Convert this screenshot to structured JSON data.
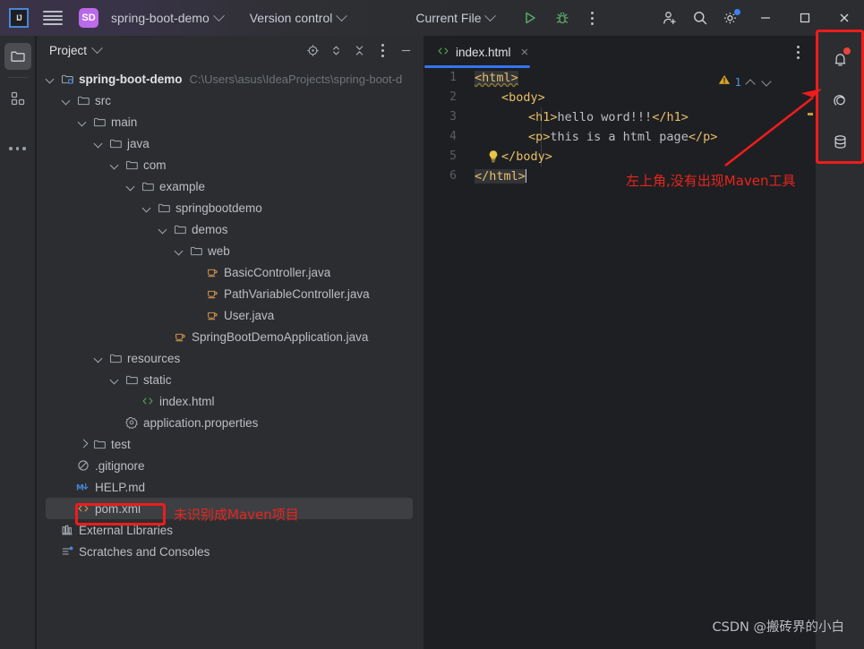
{
  "titlebar": {
    "ide_logo": "IJ",
    "menu_icon": "hamburger-menu-icon",
    "project_badge": "SD",
    "project_name": "spring-boot-demo",
    "version_control": "Version control",
    "run_config": "Current File",
    "run_icon": "run-icon",
    "debug_icon": "debug-icon",
    "more_icon": "more-options-icon",
    "account_icon": "add-account-icon",
    "search_icon": "search-icon",
    "settings_icon": "settings-gear-icon",
    "minimize": "minimize-icon",
    "maximize": "maximize-icon",
    "close": "close-icon",
    "accent": "#3574f0"
  },
  "activitybar": {
    "items": [
      {
        "name": "project-folder-icon",
        "active": true
      },
      {
        "name": "structure-icon",
        "active": false
      },
      {
        "name": "more-tool-windows-icon",
        "active": false
      }
    ]
  },
  "project_panel": {
    "title": "Project",
    "tools": [
      "locate-target-icon",
      "expand-collapse-icon",
      "collapse-all-icon",
      "panel-options-icon",
      "hide-panel-icon"
    ],
    "tree": [
      {
        "id": "root",
        "depth": 0,
        "arrow": "down",
        "icon": "module-folder-icon",
        "label": "spring-boot-demo",
        "sub": "C:\\Users\\asus\\IdeaProjects\\spring-boot-d",
        "bold": true
      },
      {
        "id": "src",
        "depth": 1,
        "arrow": "down",
        "icon": "folder-icon",
        "label": "src",
        "sub": ""
      },
      {
        "id": "main",
        "depth": 2,
        "arrow": "down",
        "icon": "folder-icon",
        "label": "main",
        "sub": ""
      },
      {
        "id": "java",
        "depth": 3,
        "arrow": "down",
        "icon": "folder-icon",
        "label": "java",
        "sub": ""
      },
      {
        "id": "com",
        "depth": 4,
        "arrow": "down",
        "icon": "folder-icon",
        "label": "com",
        "sub": ""
      },
      {
        "id": "example",
        "depth": 5,
        "arrow": "down",
        "icon": "folder-icon",
        "label": "example",
        "sub": ""
      },
      {
        "id": "sbdemo",
        "depth": 6,
        "arrow": "down",
        "icon": "folder-icon",
        "label": "springbootdemo",
        "sub": ""
      },
      {
        "id": "demos",
        "depth": 7,
        "arrow": "down",
        "icon": "folder-icon",
        "label": "demos",
        "sub": ""
      },
      {
        "id": "web",
        "depth": 8,
        "arrow": "down",
        "icon": "folder-icon",
        "label": "web",
        "sub": ""
      },
      {
        "id": "basicctl",
        "depth": 9,
        "arrow": "none",
        "icon": "java-class-icon",
        "label": "BasicController.java",
        "sub": ""
      },
      {
        "id": "pathvarctl",
        "depth": 9,
        "arrow": "none",
        "icon": "java-class-icon",
        "label": "PathVariableController.java",
        "sub": ""
      },
      {
        "id": "user",
        "depth": 9,
        "arrow": "none",
        "icon": "java-class-icon",
        "label": "User.java",
        "sub": ""
      },
      {
        "id": "sbapp",
        "depth": 7,
        "arrow": "none",
        "icon": "java-class-icon",
        "label": "SpringBootDemoApplication.java",
        "sub": ""
      },
      {
        "id": "resources",
        "depth": 3,
        "arrow": "down",
        "icon": "folder-icon",
        "label": "resources",
        "sub": ""
      },
      {
        "id": "static",
        "depth": 4,
        "arrow": "down",
        "icon": "folder-icon",
        "label": "static",
        "sub": ""
      },
      {
        "id": "indexhtml",
        "depth": 5,
        "arrow": "none",
        "icon": "html-file-icon",
        "label": "index.html",
        "sub": ""
      },
      {
        "id": "appprops",
        "depth": 4,
        "arrow": "none",
        "icon": "properties-file-icon",
        "label": "application.properties",
        "sub": ""
      },
      {
        "id": "test",
        "depth": 2,
        "arrow": "right",
        "icon": "folder-icon",
        "label": "test",
        "sub": ""
      },
      {
        "id": "gitignore",
        "depth": 1,
        "arrow": "none",
        "icon": "gitignore-icon",
        "label": ".gitignore",
        "sub": ""
      },
      {
        "id": "helpmd",
        "depth": 1,
        "arrow": "none",
        "icon": "markdown-file-icon",
        "label": "HELP.md",
        "sub": ""
      },
      {
        "id": "pomxml",
        "depth": 1,
        "arrow": "none",
        "icon": "xml-file-icon",
        "label": "pom.xml",
        "sub": "",
        "selected": true
      },
      {
        "id": "extlibs",
        "depth": 0,
        "arrow": "none",
        "icon": "external-libraries-icon",
        "label": "External Libraries",
        "sub": ""
      },
      {
        "id": "scratches",
        "depth": 0,
        "arrow": "none",
        "icon": "scratches-icon",
        "label": "Scratches and Consoles",
        "sub": ""
      }
    ]
  },
  "editor": {
    "tab": {
      "label": "index.html",
      "icon": "html-file-icon",
      "close": "×"
    },
    "options_icon": "editor-options-icon",
    "warning_count": "1",
    "warning_icon": "warning-triangle-icon",
    "nav_up_icon": "previous-problem-icon",
    "nav_down_icon": "next-problem-icon",
    "bulb_icon": "intention-bulb-icon",
    "line_numbers": [
      "1",
      "2",
      "3",
      "4",
      "5",
      "6"
    ],
    "lines": [
      {
        "n": 1,
        "indent": 0,
        "text": "<html>"
      },
      {
        "n": 2,
        "indent": 1,
        "text": "<body>"
      },
      {
        "n": 3,
        "indent": 2,
        "text": "<h1>hello word!!!</h1>"
      },
      {
        "n": 4,
        "indent": 2,
        "text": "<p>this is a html page</p>"
      },
      {
        "n": 5,
        "indent": 1,
        "text": "</body>"
      },
      {
        "n": 6,
        "indent": 0,
        "text": "</html>"
      }
    ]
  },
  "rightbar": {
    "items": [
      {
        "name": "notifications-bell-icon",
        "badge": true
      },
      {
        "name": "ai-assistant-icon",
        "badge": false
      },
      {
        "name": "database-icon",
        "badge": false
      }
    ]
  },
  "annotations": {
    "color": "#ee1c1c",
    "pom_note": "未识别成Maven项目",
    "maven_note": "左上角,没有出现Maven工具"
  },
  "watermark": "CSDN @搬砖界的小白"
}
